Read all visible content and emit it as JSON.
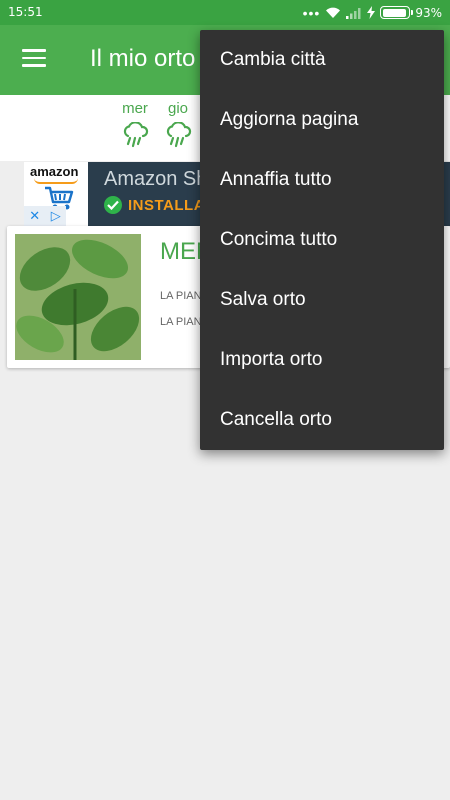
{
  "status_bar": {
    "time": "15:51",
    "battery_percent": "93%",
    "battery_level": 0.93
  },
  "app_bar": {
    "title": "Il mio orto"
  },
  "weather": {
    "days": [
      {
        "label": "mer",
        "icon": "rain-cloud-icon"
      },
      {
        "label": "gio",
        "icon": "rain-cloud-icon"
      }
    ]
  },
  "ad": {
    "logo_text": "amazon",
    "title": "Amazon Shopping",
    "install_label": "INSTALLA",
    "brand_color": "#f59c1a"
  },
  "plant_card": {
    "name": "MENTA",
    "line1": "LA PIANTA",
    "line2": "LA PIANTA"
  },
  "menu": {
    "items": [
      {
        "label": "Cambia città"
      },
      {
        "label": "Aggiorna pagina"
      },
      {
        "label": "Annaffia tutto"
      },
      {
        "label": "Concima tutto"
      },
      {
        "label": "Salva orto"
      },
      {
        "label": "Importa orto"
      },
      {
        "label": "Cancella orto"
      }
    ]
  },
  "colors": {
    "primary": "#4cae4f",
    "status_bar": "#3aa342",
    "accent_text": "#4aa74e",
    "menu_bg": "#323232",
    "background": "#eeeeee"
  }
}
